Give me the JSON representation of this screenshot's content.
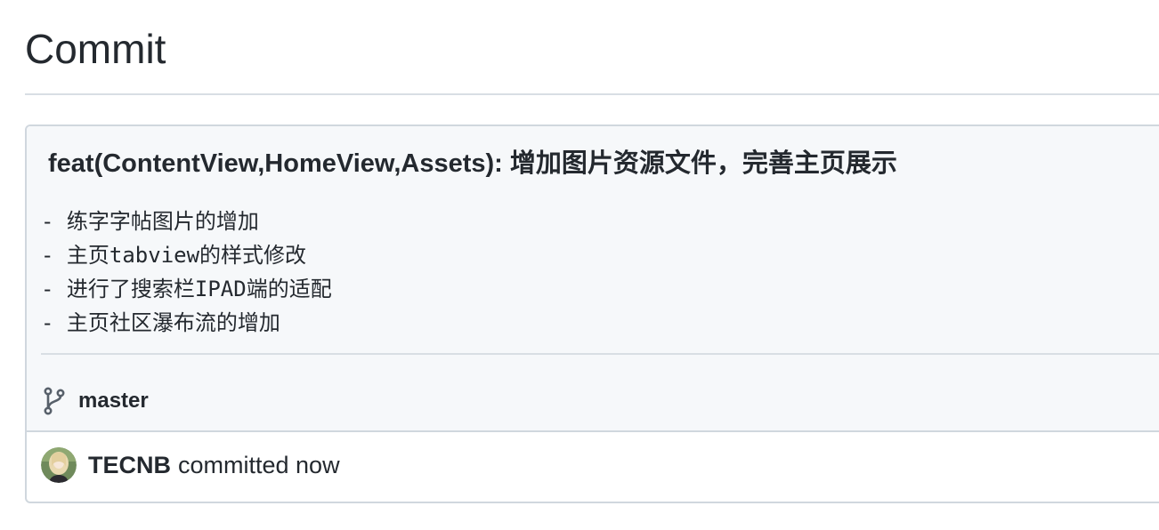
{
  "page": {
    "title": "Commit"
  },
  "commit": {
    "title": "feat(ContentView,HomeView,Assets): 增加图片资源文件，完善主页展示",
    "description_lines": [
      "- 练字字帖图片的增加",
      "- 主页tabview的样式修改",
      "- 进行了搜索栏IPAD端的适配",
      "- 主页社区瀑布流的增加"
    ],
    "branch": "master",
    "author": "TECNB",
    "meta_text": "committed now"
  },
  "icons": {
    "branch": "git-branch-icon",
    "avatar": "user-avatar"
  },
  "colors": {
    "text": "#24292f",
    "header_bg": "#f6f8fa",
    "border": "#d0d7de"
  }
}
